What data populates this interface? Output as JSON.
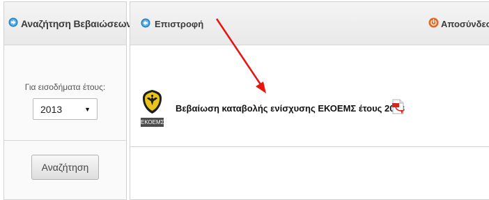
{
  "left": {
    "header_title": "Αναζήτηση Βεβαιώσεων",
    "header_icon": "forward-arrow-icon",
    "year_label": "Για εισοδήματα έτους:",
    "year_selected": "2013",
    "search_button": "Αναζήτηση"
  },
  "right": {
    "back_label": "Επιστροφή",
    "back_icon": "back-arrow-icon",
    "logout_label": "Αποσύνδεσ",
    "logout_icon": "power-icon",
    "documents": [
      {
        "title": "Βεβαίωση καταβολής ενίσχυσης ΕΚΟΕΜΣ έτους 2013",
        "logo_text": "ΕΚΟΕΜΣ",
        "file_icon": "pdf-icon"
      }
    ]
  },
  "colors": {
    "accent_blue": "#1f7fc8",
    "logout_orange": "#e8661c",
    "annotation_red": "#e8140f",
    "header_bg": "#eeeeee"
  }
}
